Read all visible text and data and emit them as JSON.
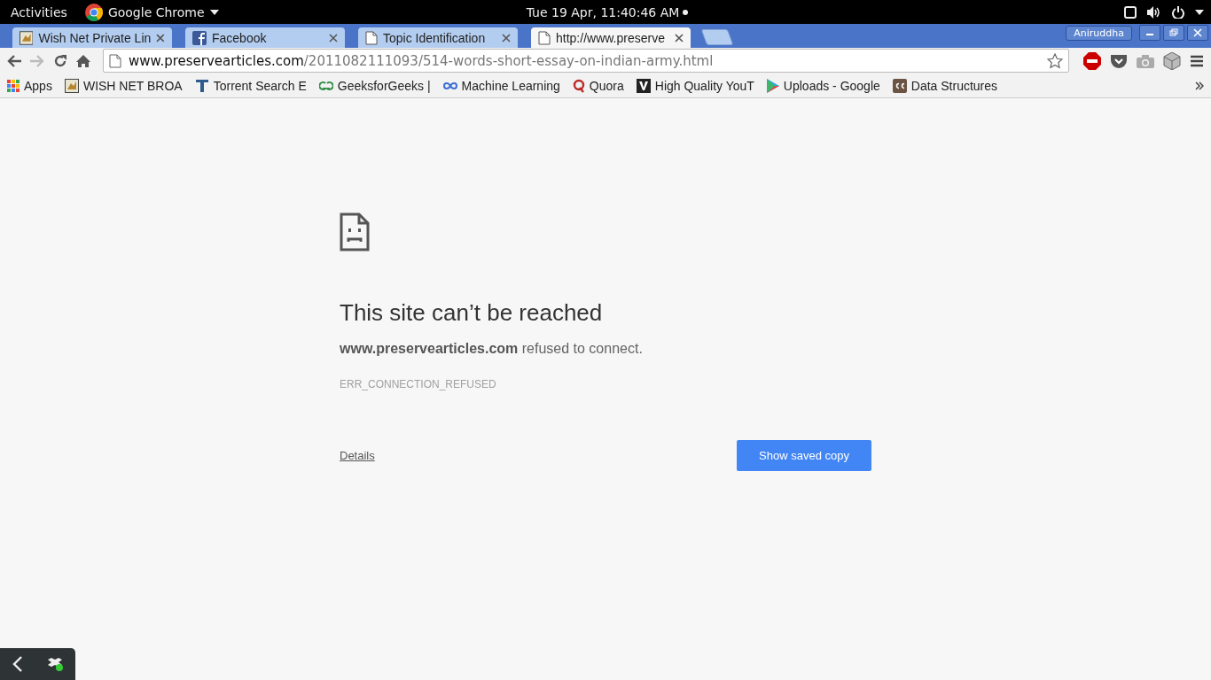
{
  "top_bar": {
    "activities": "Activities",
    "app_name": "Google Chrome",
    "clock": "Tue 19 Apr, 11:40:46 AM"
  },
  "tabs": [
    {
      "title": "Wish Net Private Lin",
      "selected": false
    },
    {
      "title": "Facebook",
      "selected": false
    },
    {
      "title": "Topic Identification",
      "selected": false
    },
    {
      "title": "http://www.preserve",
      "selected": true
    }
  ],
  "profile": "Aniruddha",
  "url": {
    "host": "www.preservearticles.com",
    "path": "/2011082111093/514-words-short-essay-on-indian-army.html"
  },
  "bookmarks": [
    "Apps",
    "WISH NET BROA",
    "Torrent Search E",
    "GeeksforGeeks |",
    "Machine Learning",
    "Quora",
    "High Quality YouT",
    "Uploads - Google",
    "Data Structures"
  ],
  "error": {
    "title": "This site can’t be reached",
    "message": "**www.preservearticles.com** refused to connect.",
    "code": "ERR_CONNECTION_REFUSED",
    "details": "Details",
    "button": "Show saved copy"
  }
}
